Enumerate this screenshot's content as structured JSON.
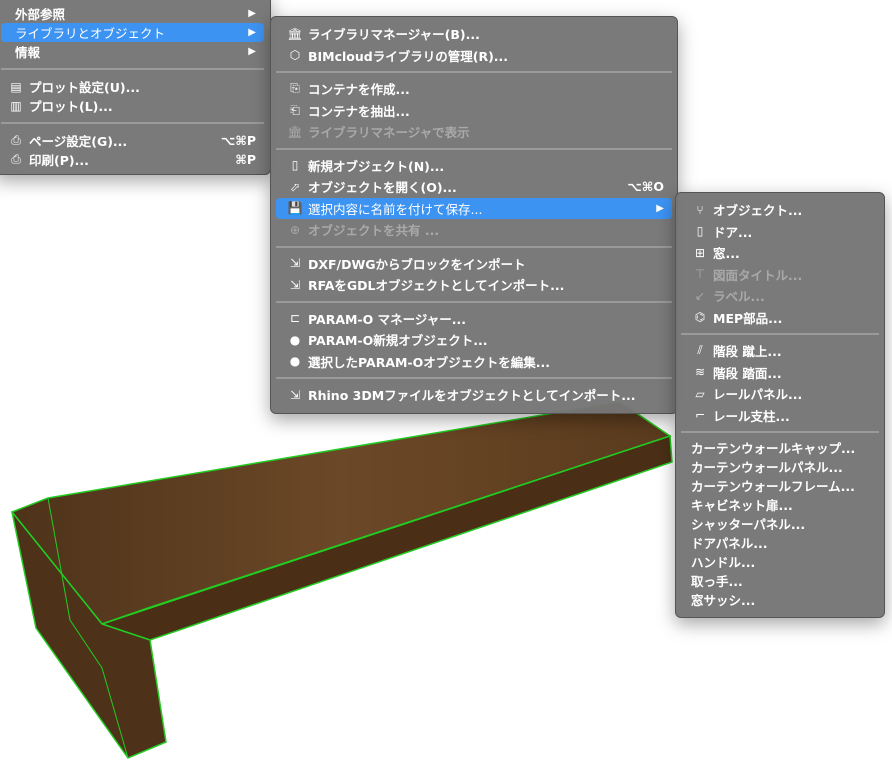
{
  "menu_main": {
    "items": [
      {
        "label": "外部参照",
        "arrow": "▶"
      },
      {
        "label": "ライブラリとオブジェクト",
        "arrow": "▶"
      },
      {
        "label": "情報",
        "arrow": "▶"
      },
      {
        "label": "プロット設定(U)...",
        "icon": "plot-setup-icon"
      },
      {
        "label": "プロット(L)...",
        "icon": "plot-icon"
      },
      {
        "label": "ページ設定(G)...",
        "shortcut": "⌥⌘P",
        "icon": "page-setup-icon"
      },
      {
        "label": "印刷(P)...",
        "shortcut": "⌘P",
        "icon": "printer-icon"
      }
    ]
  },
  "menu_library": {
    "items": [
      {
        "label": "ライブラリマネージャー(B)..."
      },
      {
        "label": "BIMcloudライブラリの管理(R)..."
      },
      {
        "label": "コンテナを作成..."
      },
      {
        "label": "コンテナを抽出..."
      },
      {
        "label": "ライブラリマネージャで表示"
      },
      {
        "label": "新規オブジェクト(N)..."
      },
      {
        "label": "オブジェクトを開く(O)...",
        "shortcut": "⌥⌘O"
      },
      {
        "label": "選択内容に名前を付けて保存...",
        "arrow": "▶"
      },
      {
        "label": "オブジェクトを共有 ..."
      },
      {
        "label": "DXF/DWGからブロックをインポート"
      },
      {
        "label": "RFAをGDLオブジェクトとしてインポート..."
      },
      {
        "label": "PARAM-O マネージャー..."
      },
      {
        "label": "PARAM-O新規オブジェクト..."
      },
      {
        "label": "選択したPARAM-Oオブジェクトを編集..."
      },
      {
        "label": "Rhino 3DMファイルをオブジェクトとしてインポート..."
      }
    ]
  },
  "menu_save_as": {
    "items": [
      {
        "label": "オブジェクト..."
      },
      {
        "label": "ドア..."
      },
      {
        "label": "窓..."
      },
      {
        "label": "図面タイトル..."
      },
      {
        "label": "ラベル..."
      },
      {
        "label": "MEP部品..."
      },
      {
        "label": "階段 蹴上..."
      },
      {
        "label": "階段 踏面..."
      },
      {
        "label": "レールパネル..."
      },
      {
        "label": "レール支柱..."
      },
      {
        "label": "カーテンウォールキャップ..."
      },
      {
        "label": "カーテンウォールパネル..."
      },
      {
        "label": "カーテンウォールフレーム..."
      },
      {
        "label": "キャビネット扉..."
      },
      {
        "label": "シャッターパネル..."
      },
      {
        "label": "ドアパネル..."
      },
      {
        "label": "ハンドル..."
      },
      {
        "label": "取っ手..."
      },
      {
        "label": "窓サッシ..."
      }
    ]
  },
  "colors": {
    "highlight": "#3d93f2",
    "wood": "#5a3a1c",
    "edge": "#22cc22"
  }
}
